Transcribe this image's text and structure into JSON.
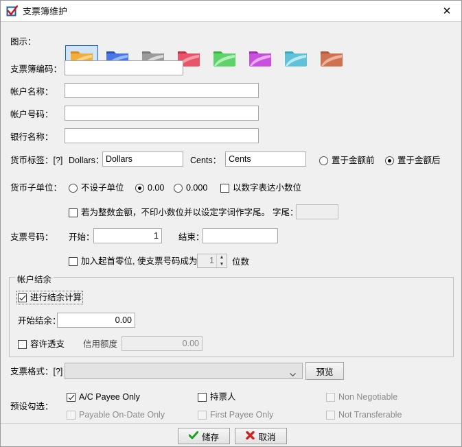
{
  "window": {
    "title": "支票簿维护",
    "icon": "checkmark-box-icon",
    "close_label": "✕"
  },
  "icon_row": {
    "label": "图示：",
    "selected_index": 0,
    "folders": [
      {
        "name": "folder-orange",
        "color": "#f0ae3c",
        "light": "#fbdc9d",
        "tab": "#e08a12"
      },
      {
        "name": "folder-blue",
        "color": "#4a76e8",
        "light": "#a8c3fb",
        "tab": "#2b4fc4"
      },
      {
        "name": "folder-gray",
        "color": "#9b9b9b",
        "light": "#e0e0e0",
        "tab": "#7a7a7a"
      },
      {
        "name": "folder-red",
        "color": "#e8556a",
        "light": "#f7a9b5",
        "tab": "#cf2a46"
      },
      {
        "name": "folder-green",
        "color": "#5fd36a",
        "light": "#b3f0ba",
        "tab": "#37b845"
      },
      {
        "name": "folder-purple",
        "color": "#c850dc",
        "light": "#ecacf3",
        "tab": "#a828c0"
      },
      {
        "name": "folder-cyan",
        "color": "#5fc2d8",
        "light": "#bfeaf3",
        "tab": "#3aa8c2"
      },
      {
        "name": "folder-brown",
        "color": "#cf7250",
        "light": "#edb49b",
        "tab": "#b5573a"
      }
    ]
  },
  "fields": {
    "book_code": {
      "label": "支票簿编码：",
      "value": ""
    },
    "account_name": {
      "label": "帐户名称：",
      "value": ""
    },
    "account_number": {
      "label": "帐户号码：",
      "value": ""
    },
    "bank_name": {
      "label": "银行名称：",
      "value": ""
    }
  },
  "currency_label": {
    "label": "货币标签：[?]",
    "dollars_label": "Dollars：",
    "dollars_value": "Dollars",
    "cents_label": "Cents：",
    "cents_value": "Cents",
    "position_before": "置于金额前",
    "position_after": "置于金额后",
    "position_selected": "after"
  },
  "currency_sub": {
    "label": "货币子单位：",
    "options": [
      {
        "label": "不设子单位",
        "selected": false
      },
      {
        "label": "0.00",
        "selected": true
      },
      {
        "label": "0.000",
        "selected": false
      }
    ],
    "numeric_decimal": {
      "label": "以数字表达小数位",
      "checked": false
    }
  },
  "whole_amount": {
    "checkbox_label": "若为整数金额，不印小数位并以设定字词作字尾。",
    "checked": false,
    "suffix_label": "字尾：",
    "suffix_value": ""
  },
  "check_number": {
    "label": "支票号码：",
    "start_label": "开始：",
    "start_value": "1",
    "end_label": "结束：",
    "end_value": "",
    "pad_label": "加入起首零位, 使支票号码成为",
    "pad_checked": false,
    "pad_digits": "1",
    "digits_label": "位数"
  },
  "balance_group": {
    "title": "帐户结余",
    "calc": {
      "label": "进行结余计算",
      "checked": true
    },
    "opening_label": "开始结余：",
    "opening_value": "0.00",
    "overdraft": {
      "label": "容许透支",
      "checked": false
    },
    "credit_limit_label": "信用额度",
    "credit_limit_value": "0.00"
  },
  "check_format": {
    "label": "支票格式：[?]",
    "selected": "",
    "preview_button": "预览"
  },
  "preset_checks": {
    "label": "预设勾选：",
    "items": [
      {
        "label": "A/C Payee Only",
        "checked": true,
        "enabled": true
      },
      {
        "label": "持票人",
        "checked": false,
        "enabled": true
      },
      {
        "label": "Non Negotiable",
        "checked": false,
        "enabled": false
      },
      {
        "label": "Payable On-Date Only",
        "checked": false,
        "enabled": false
      },
      {
        "label": "First Payee Only",
        "checked": false,
        "enabled": false
      },
      {
        "label": "Not Transferable",
        "checked": false,
        "enabled": false
      }
    ]
  },
  "footer": {
    "save_label": "储存",
    "cancel_label": "取消"
  },
  "colors": {
    "accent_selection": "#cfe4f7",
    "selection_border": "#1a5fa8",
    "dialog_bg": "#f0f0f0",
    "save_icon": "#1f9e23",
    "cancel_icon": "#cc2222"
  }
}
